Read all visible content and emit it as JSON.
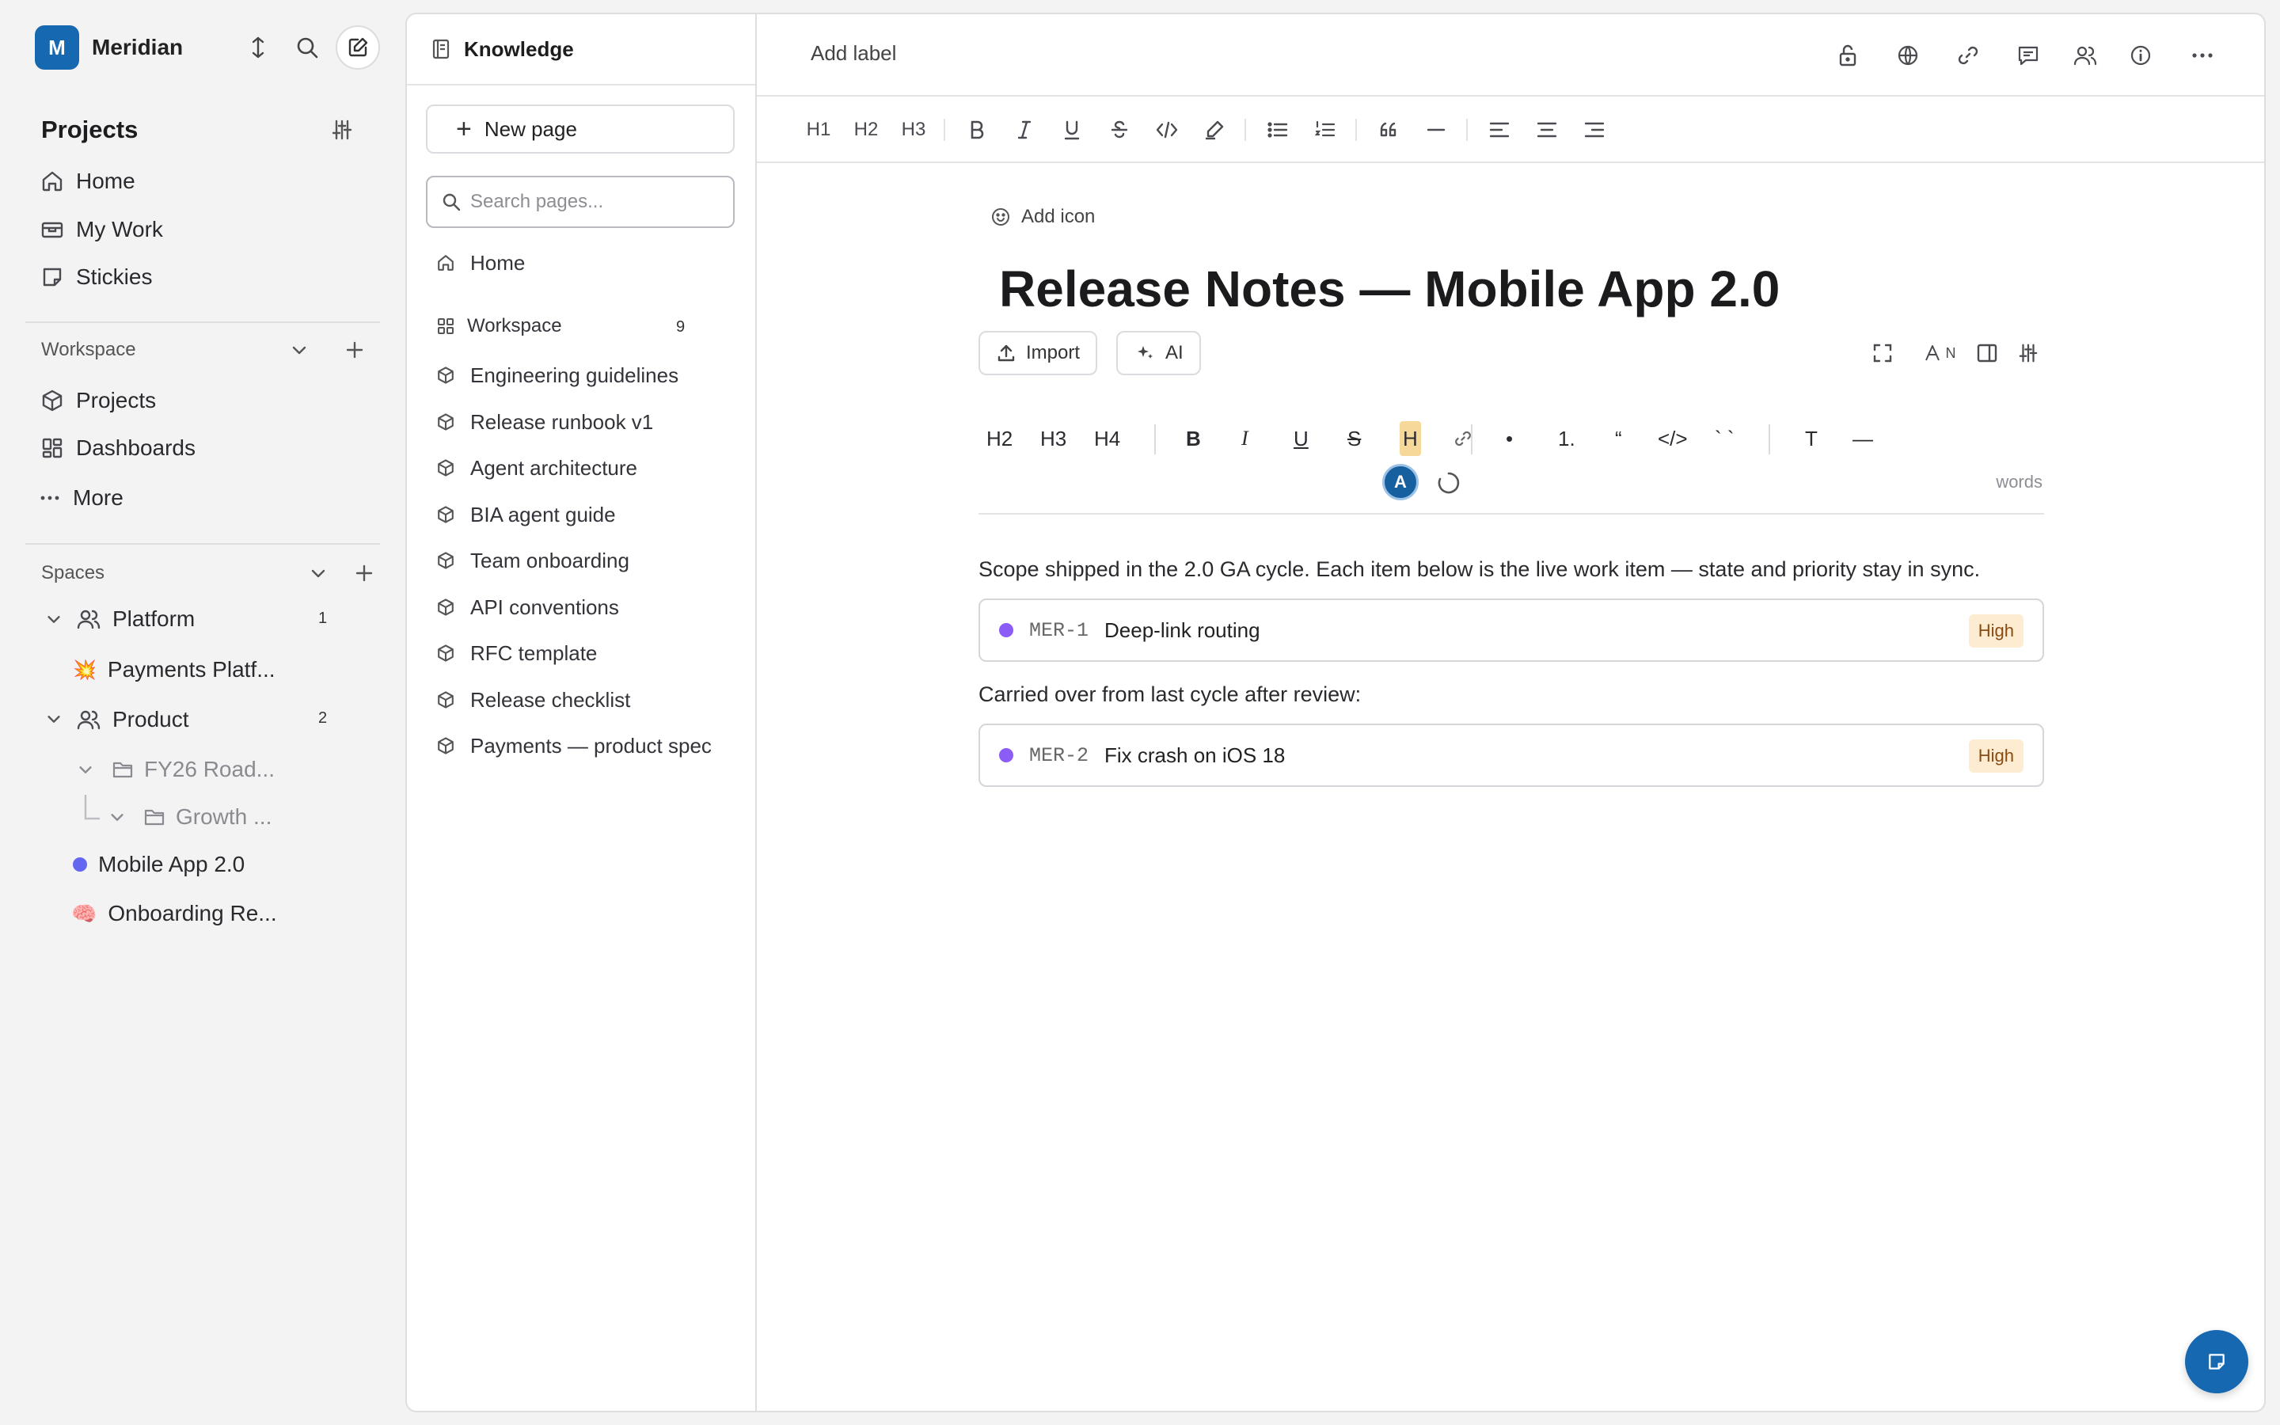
{
  "workspace": {
    "initial": "M",
    "name": "Meridian"
  },
  "sidebar": {
    "projects_title": "Projects",
    "nav": [
      {
        "label": "Home",
        "icon": "home-icon"
      },
      {
        "label": "My Work",
        "icon": "briefcase-icon"
      },
      {
        "label": "Stickies",
        "icon": "sticky-note-icon"
      }
    ],
    "workspace_label": "Workspace",
    "workspace_items": [
      {
        "label": "Projects",
        "icon": "cube-icon"
      },
      {
        "label": "Dashboards",
        "icon": "grid-icon"
      },
      {
        "label": "More",
        "icon": "ellipsis-icon"
      }
    ],
    "spaces_label": "Spaces",
    "spaces": {
      "platform": {
        "label": "Platform",
        "count": "1"
      },
      "payments": {
        "label": "Payments Platf...",
        "emoji": "💥"
      },
      "product": {
        "label": "Product",
        "count": "2"
      },
      "fy26": {
        "label": "FY26 Road..."
      },
      "growth": {
        "label": "Growth ..."
      },
      "mobile": {
        "label": "Mobile App 2.0",
        "color": "#6366f1"
      },
      "onboarding": {
        "label": "Onboarding Re...",
        "emoji": "🧠"
      }
    }
  },
  "knowledge": {
    "title": "Knowledge",
    "new_page_label": "New page",
    "search_placeholder": "Search pages...",
    "home_label": "Home",
    "workspace_label": "Workspace",
    "workspace_count": "9",
    "pages": [
      "Engineering guidelines",
      "Release runbook v1",
      "Agent architecture",
      "BIA agent guide",
      "Team onboarding",
      "API conventions",
      "RFC template",
      "Release checklist",
      "Payments — product spec"
    ]
  },
  "editor": {
    "add_label": "Add label",
    "format_bar": {
      "h1": "H1",
      "h2": "H2",
      "h3": "H3"
    },
    "add_icon_label": "Add icon",
    "title": "Release Notes — Mobile App 2.0",
    "import_label": "Import",
    "ai_label": "AI",
    "font_toggle_label": "N",
    "toolbar": {
      "h2": "H2",
      "h3": "H3",
      "h4": "H4",
      "bold": "B",
      "italic": "I",
      "underline": "U",
      "strike": "S",
      "highlight": "H",
      "bullet": "•",
      "ordered": "1.",
      "quote": "“",
      "code": "</>",
      "inline_code": "` `",
      "text": "T",
      "rule": "—"
    },
    "presence_initial": "A",
    "words_label": "words",
    "paragraph_1": "Scope shipped in the 2.0 GA cycle. Each item below is the live work item — state and priority stay in sync.",
    "item_1": {
      "id": "MER-1",
      "title": "Deep-link routing",
      "priority": "High"
    },
    "paragraph_2": "Carried over from last cycle after review:",
    "item_2": {
      "id": "MER-2",
      "title": "Fix crash on iOS 18",
      "priority": "High"
    }
  },
  "colors": {
    "accent": "#1668b0",
    "state_dot": "#8b5cf6",
    "priority_bg": "#fdecd2",
    "priority_text": "#8a4b10"
  }
}
